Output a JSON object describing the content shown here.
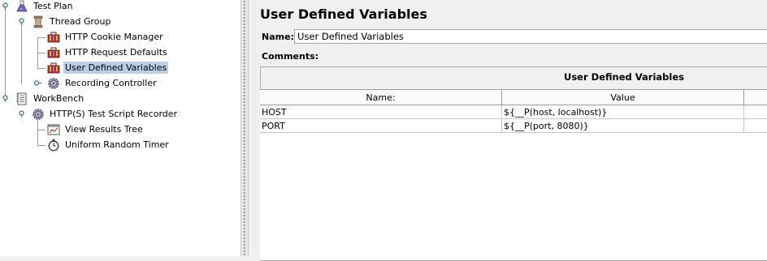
{
  "tree": {
    "items": [
      {
        "label": "Test Plan",
        "icon": "flask-icon"
      },
      {
        "label": "Thread Group",
        "icon": "spool-icon"
      },
      {
        "label": "HTTP Cookie Manager",
        "icon": "toolbox-icon"
      },
      {
        "label": "HTTP Request Defaults",
        "icon": "toolbox-icon"
      },
      {
        "label": "User Defined Variables",
        "icon": "toolbox-icon",
        "selected": true
      },
      {
        "label": "Recording Controller",
        "icon": "gear-icon"
      },
      {
        "label": "WorkBench",
        "icon": "notepad-icon"
      },
      {
        "label": "HTTP(S) Test Script Recorder",
        "icon": "gear-icon"
      },
      {
        "label": "View Results Tree",
        "icon": "graph-window-icon"
      },
      {
        "label": "Uniform Random Timer",
        "icon": "stopwatch-icon"
      }
    ]
  },
  "panel": {
    "title": "User Defined Variables",
    "name_label": "Name:",
    "name_value": "User Defined Variables",
    "comments_label": "Comments:",
    "variables_title": "User Defined Variables",
    "columns": [
      "Name:",
      "Value",
      ""
    ],
    "rows": [
      {
        "name": "HOST",
        "value": "${__P(host, localhost)}"
      },
      {
        "name": "PORT",
        "value": "${__P(port, 8080)}"
      }
    ]
  },
  "colors": {
    "selection": "#b8cfe5",
    "tree_background": "#ffffff",
    "panel_background": "#f0f0f0"
  }
}
